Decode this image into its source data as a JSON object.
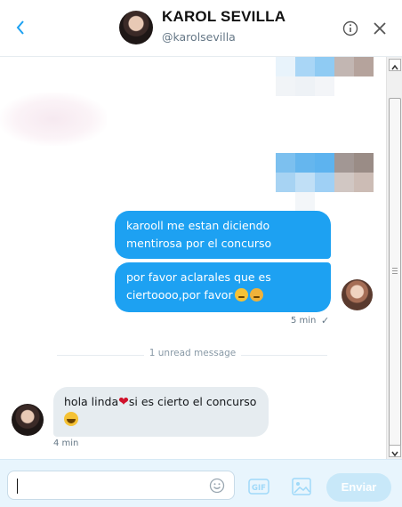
{
  "header": {
    "title": "KAROL SEVILLA",
    "handle": "@karolsevilla"
  },
  "messages": {
    "out_1": "karooll me estan diciendo mentirosa por el concurso",
    "out_2": "por favor aclarales que es ciertoooo,por favor",
    "out_time": "5 min",
    "out_status": "✓",
    "unread_label": "1 unread message",
    "in_1": "hola linda",
    "in_1_rest": "si es cierto el concurso",
    "in_time": "4 min"
  },
  "composer": {
    "send_label": "Enviar",
    "gif_label": "GIF"
  },
  "colors": {
    "accent": "#1da1f2",
    "incoming_bubble": "#e6ecf0",
    "composer_bg": "#e8f5fd"
  }
}
